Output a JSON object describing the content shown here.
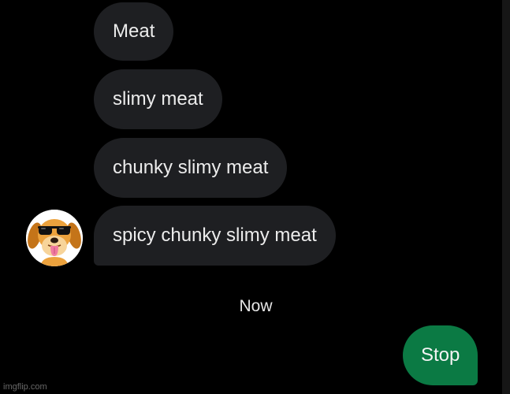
{
  "conversation": {
    "incoming_messages": [
      {
        "text": "Meat"
      },
      {
        "text": "slimy meat"
      },
      {
        "text": "chunky slimy meat"
      },
      {
        "text": "spicy chunky slimy meat"
      }
    ],
    "sender_avatar_icon": "dog-with-sunglasses-avatar",
    "timestamp": "Now",
    "outgoing_message": {
      "text": "Stop"
    }
  },
  "watermark": "imgflip.com",
  "colors": {
    "background": "#000000",
    "incoming_bubble": "#1e1f22",
    "outgoing_bubble": "#0b7a44",
    "text": "#ececec"
  }
}
